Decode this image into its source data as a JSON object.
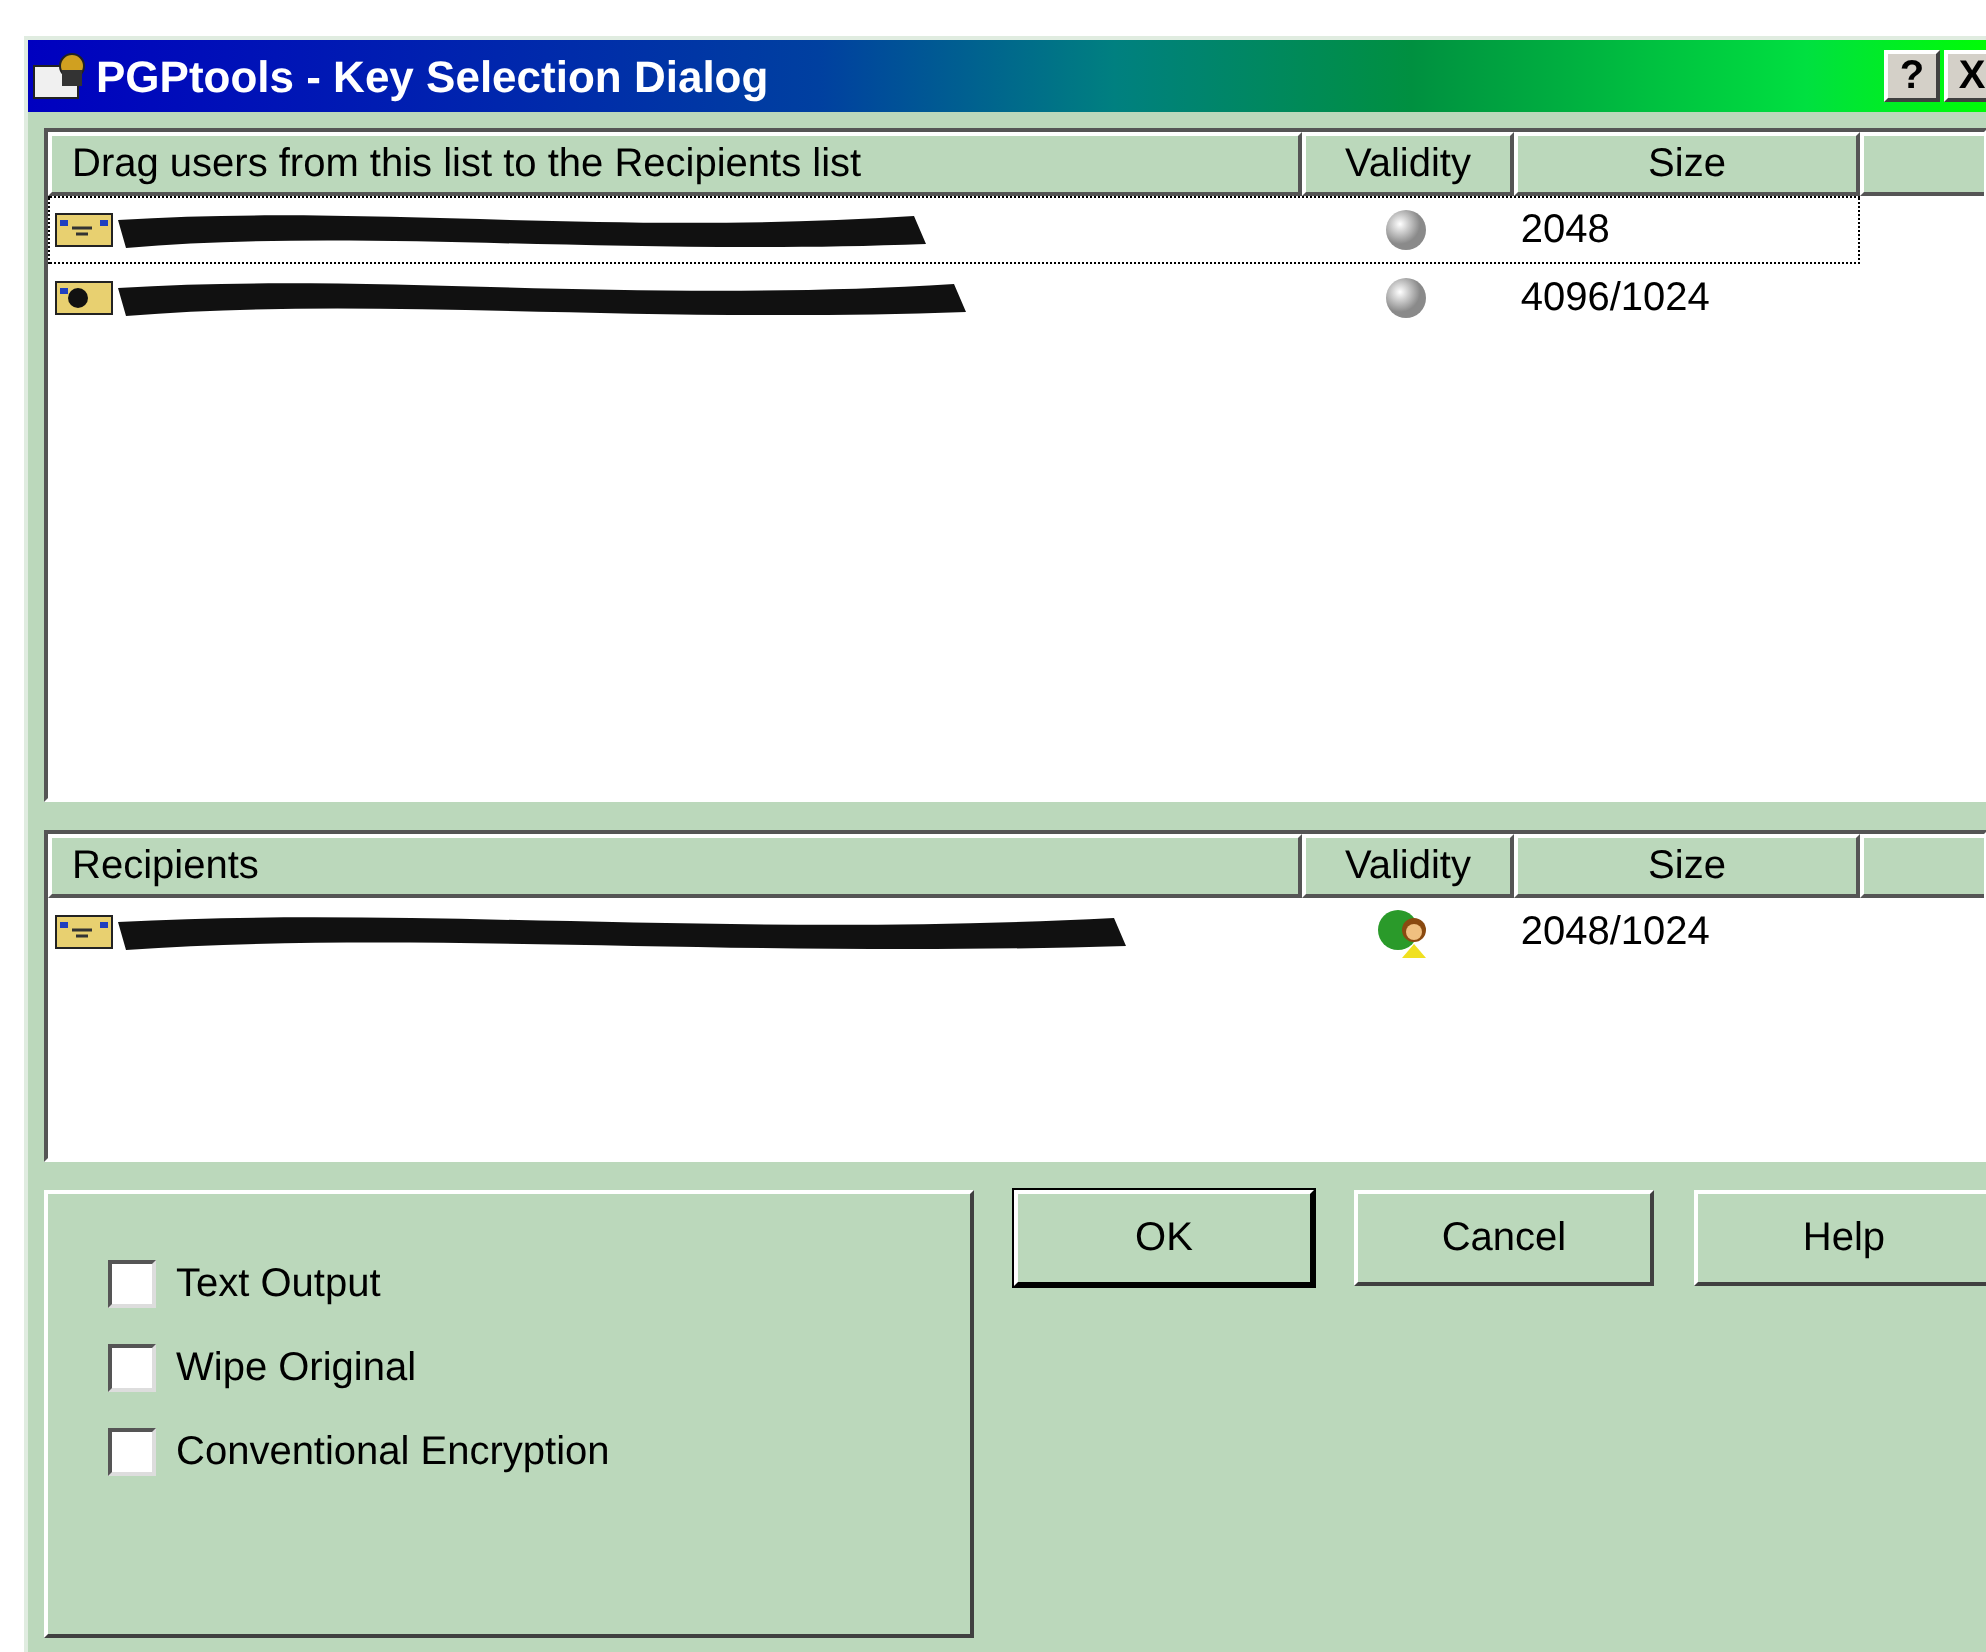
{
  "window": {
    "title": "PGPtools - Key Selection Dialog",
    "buttons": [
      "?",
      "X"
    ]
  },
  "key_list": {
    "columns": [
      "Drag users from this list to the Recipients list",
      "Validity",
      "Size"
    ],
    "rows": [
      {
        "kind": "key",
        "valid": false,
        "size": "2048",
        "focused": true
      },
      {
        "kind": "keypair",
        "valid": false,
        "size": "4096/1024",
        "focused": false
      }
    ]
  },
  "recipients": {
    "columns": [
      "Recipients",
      "Validity",
      "Size"
    ],
    "rows": [
      {
        "kind": "key",
        "valid": true,
        "size": "2048/1024",
        "focused": false
      }
    ]
  },
  "options": [
    {
      "label": "Text Output",
      "checked": false
    },
    {
      "label": "Wipe Original",
      "checked": false
    },
    {
      "label": "Conventional Encryption",
      "checked": false
    }
  ],
  "buttons": [
    {
      "label": "OK",
      "default": true
    },
    {
      "label": "Cancel",
      "default": false
    },
    {
      "label": "Help",
      "default": false
    }
  ]
}
